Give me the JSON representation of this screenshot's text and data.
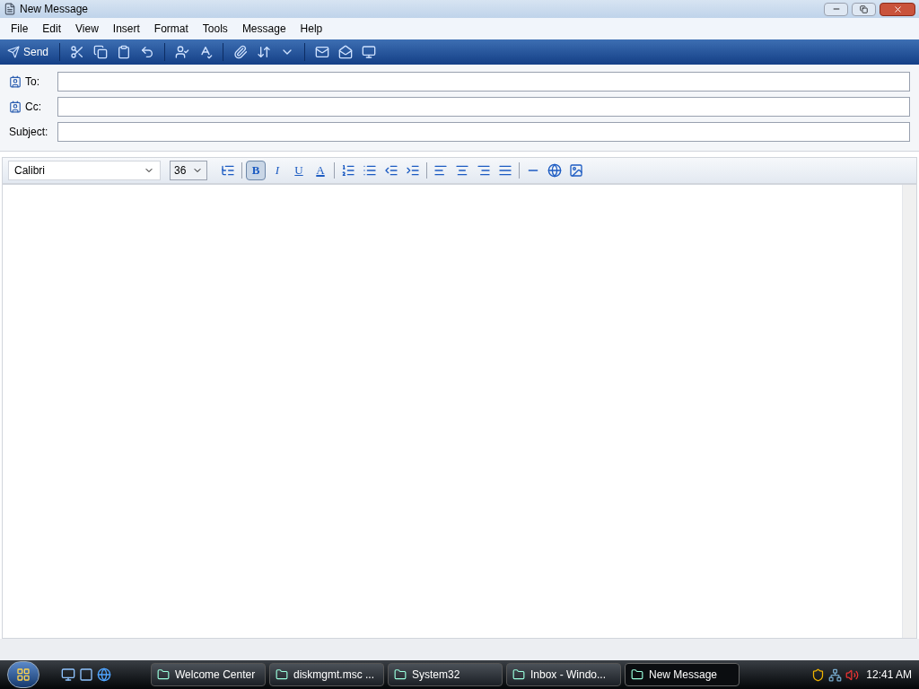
{
  "window": {
    "title": "New Message"
  },
  "menu": [
    "File",
    "Edit",
    "View",
    "Insert",
    "Format",
    "Tools",
    "Message",
    "Help"
  ],
  "toolbar": {
    "send": "Send"
  },
  "fields": [
    {
      "label": "To:",
      "kind": "address"
    },
    {
      "label": "Cc:",
      "kind": "address"
    },
    {
      "label": "Subject:",
      "kind": "plain"
    }
  ],
  "format_bar": {
    "font": "Calibri",
    "size": "36",
    "styles": [
      {
        "label": "B",
        "kind": "bold",
        "selected": true
      },
      {
        "label": "I",
        "kind": "italic",
        "selected": false
      },
      {
        "label": "U",
        "kind": "underline",
        "selected": false
      },
      {
        "label": "A",
        "kind": "color",
        "selected": false
      }
    ]
  },
  "taskbar": {
    "items": [
      {
        "label": "Welcome Center",
        "selected": false
      },
      {
        "label": "diskmgmt.msc ...",
        "selected": false
      },
      {
        "label": "System32",
        "selected": false
      },
      {
        "label": "Inbox - Windo...",
        "selected": false
      },
      {
        "label": "New Message",
        "selected": true
      }
    ],
    "clock": "12:41 AM"
  }
}
